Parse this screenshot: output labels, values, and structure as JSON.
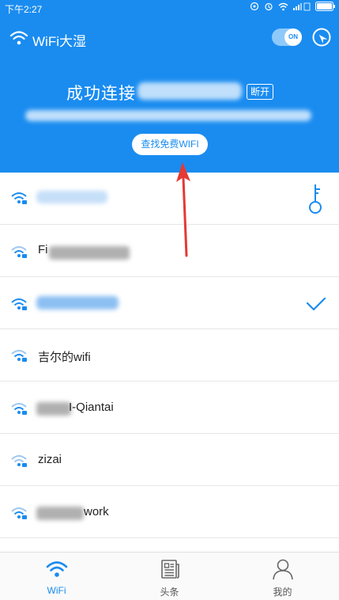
{
  "status_bar": {
    "time": "下午2:27",
    "battery_label": ""
  },
  "app_bar": {
    "title": "WiFi大湿",
    "toggle_label": "ON"
  },
  "banner": {
    "connect_prefix": "成功连接",
    "disconnect_label": "断开",
    "find_free_wifi_label": "查找免费WIFI"
  },
  "networks": [
    {
      "name": "",
      "badge": "key"
    },
    {
      "name": "Fi",
      "badge": ""
    },
    {
      "name": "",
      "badge": "check"
    },
    {
      "name": "吉尔的wifi",
      "badge": ""
    },
    {
      "name": "I-Qiantai",
      "badge": ""
    },
    {
      "name": "zizai",
      "badge": ""
    },
    {
      "name": "work",
      "badge": ""
    }
  ],
  "tabs": [
    {
      "label": "WiFi",
      "active": true,
      "icon": "wifi-icon"
    },
    {
      "label": "头条",
      "active": false,
      "icon": "news-icon"
    },
    {
      "label": "我的",
      "active": false,
      "icon": "user-icon"
    }
  ],
  "colors": {
    "accent": "#1a8cf0",
    "annotation_arrow": "#e53935"
  }
}
